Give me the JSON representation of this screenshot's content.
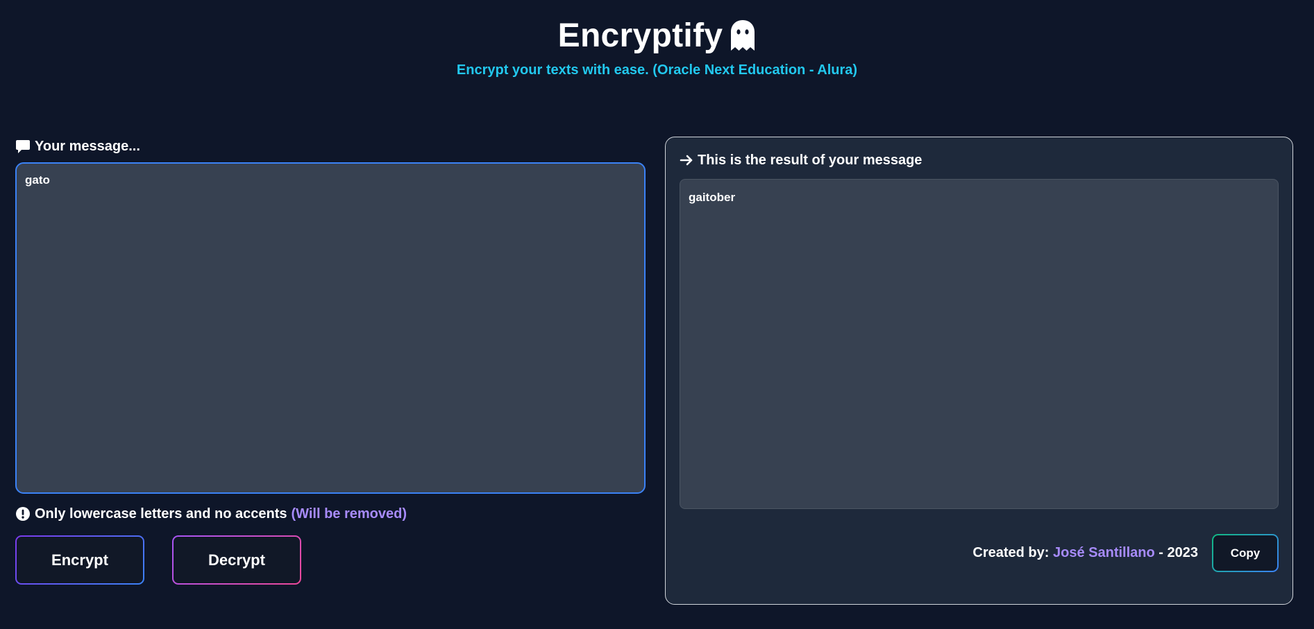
{
  "header": {
    "title": "Encryptify",
    "title_icon": "ghost-icon",
    "subtitle": "Encrypt your texts with ease. (Oracle Next Education - Alura)"
  },
  "input_section": {
    "label_icon": "message-bubble-icon",
    "label": "Your message...",
    "value": "gato",
    "hint_icon": "exclamation-circle-icon",
    "hint_text": "Only lowercase letters and no accents",
    "hint_accent": "(Will be removed)"
  },
  "actions": {
    "encrypt_label": "Encrypt",
    "decrypt_label": "Decrypt"
  },
  "result_section": {
    "label_icon": "arrow-right-icon",
    "label": "This is the result of your message",
    "value": "gaitober",
    "credit_prefix": "Created by:",
    "author": "José Santillano",
    "credit_suffix": "- 2023",
    "copy_label": "Copy"
  },
  "colors": {
    "background": "#0e1629",
    "panel": "#1e293b",
    "textarea": "#374151",
    "subtitle": "#22c8ee",
    "accent": "#a78bfa",
    "focus_border": "#3b82f6"
  }
}
